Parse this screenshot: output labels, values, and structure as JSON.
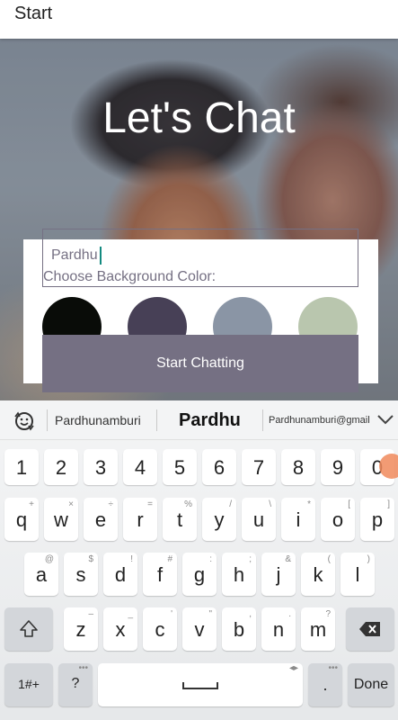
{
  "appbar": {
    "title": "Start"
  },
  "heading": "Let's Chat",
  "form": {
    "name_value": "Pardhu",
    "choose_label": "Choose Background Color:",
    "colors": [
      "#090C08",
      "#474056",
      "#8A95A5",
      "#B9C6AE"
    ],
    "start_button": "Start Chatting"
  },
  "keyboard": {
    "suggestions": [
      "Pardhunamburi",
      "Pardhu",
      "Pardhunamburi@gmail"
    ],
    "numbers": [
      "1",
      "2",
      "3",
      "4",
      "5",
      "6",
      "7",
      "8",
      "9",
      "0"
    ],
    "row1": [
      {
        "k": "q",
        "s": "+"
      },
      {
        "k": "w",
        "s": "×"
      },
      {
        "k": "e",
        "s": "÷"
      },
      {
        "k": "r",
        "s": "="
      },
      {
        "k": "t",
        "s": "%"
      },
      {
        "k": "y",
        "s": "/"
      },
      {
        "k": "u",
        "s": "\\"
      },
      {
        "k": "i",
        "s": "*"
      },
      {
        "k": "o",
        "s": "["
      },
      {
        "k": "p",
        "s": "]"
      }
    ],
    "row2": [
      {
        "k": "a",
        "s": "@"
      },
      {
        "k": "s",
        "s": "$"
      },
      {
        "k": "d",
        "s": "!"
      },
      {
        "k": "f",
        "s": "#"
      },
      {
        "k": "g",
        "s": ":"
      },
      {
        "k": "h",
        "s": ";"
      },
      {
        "k": "j",
        "s": "&"
      },
      {
        "k": "k",
        "s": "("
      },
      {
        "k": "l",
        "s": ")"
      }
    ],
    "row3": [
      {
        "k": "z",
        "s": "–"
      },
      {
        "k": "x",
        "s": "_"
      },
      {
        "k": "c",
        "s": "'"
      },
      {
        "k": "v",
        "s": "\""
      },
      {
        "k": "b",
        "s": ","
      },
      {
        "k": "n",
        "s": "."
      },
      {
        "k": "m",
        "s": "?"
      }
    ],
    "symbols_key": "1#+",
    "question_key": "?",
    "space_key": "␣",
    "period_key": ".",
    "done_key": "Done"
  }
}
